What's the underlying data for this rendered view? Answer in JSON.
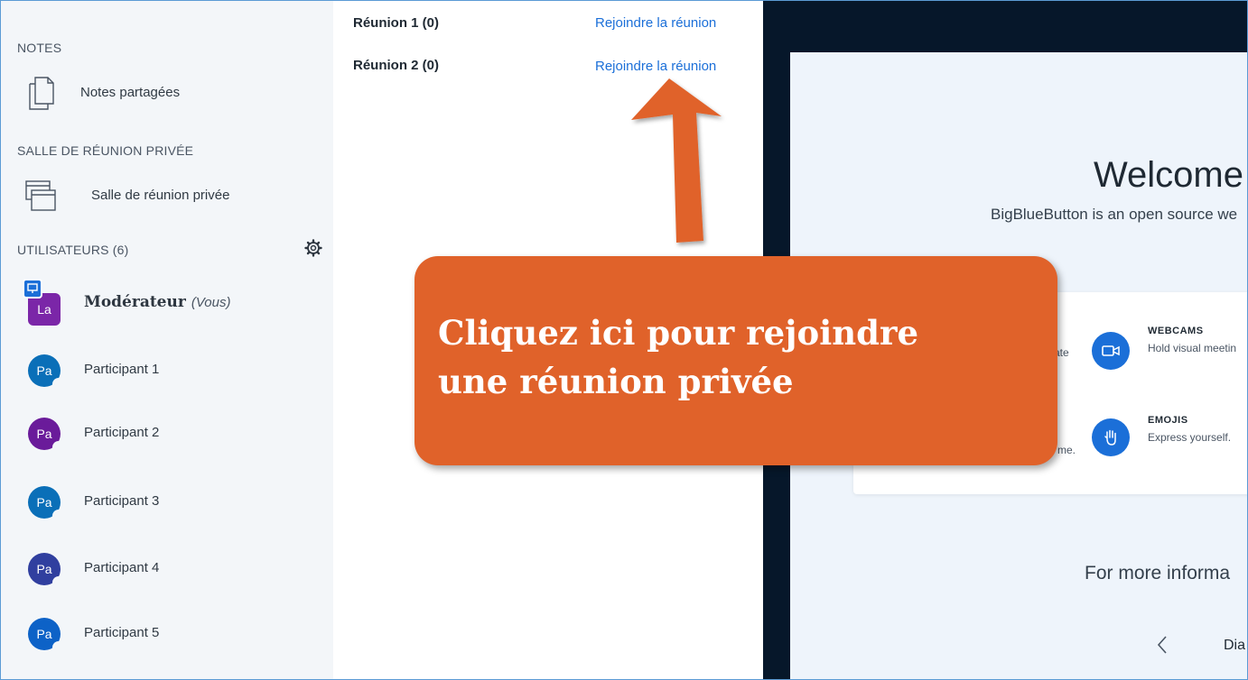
{
  "sidebar": {
    "notes_title": "NOTES",
    "notes_item": "Notes partagées",
    "breakout_title": "SALLE DE RÉUNION PRIVÉE",
    "breakout_item": "Salle de réunion privée",
    "users_title": "UTILISATEURS (6)",
    "moderator": {
      "initials": "La",
      "name": "Modérateur",
      "you": "(Vous)",
      "color": "#7b26a8"
    },
    "users": [
      {
        "initials": "Pa",
        "name": "Participant 1",
        "color": "#0a6fb8"
      },
      {
        "initials": "Pa",
        "name": "Participant 2",
        "color": "#6a1b9a"
      },
      {
        "initials": "Pa",
        "name": "Participant 3",
        "color": "#0a6fb8"
      },
      {
        "initials": "Pa",
        "name": "Participant 4",
        "color": "#303f9f"
      },
      {
        "initials": "Pa",
        "name": "Participant 5",
        "color": "#0d62c7"
      }
    ]
  },
  "rooms": [
    {
      "name": "Réunion 1 (0)",
      "join": "Rejoindre la réunion"
    },
    {
      "name": "Réunion 2 (0)",
      "join": "Rejoindre la réunion"
    }
  ],
  "presentation": {
    "welcome": "Welcome T",
    "subtitle": "BigBlueButton is an open source we",
    "features": [
      {
        "title": "WEBCAMS",
        "desc": "Hold visual meetin",
        "icon": "webcam-icon"
      },
      {
        "title": "EMOJIS",
        "desc": "Express yourself.",
        "icon": "hand-icon"
      }
    ],
    "partial_left_1": "ate",
    "partial_left_2": "me.",
    "more_info": "For more informa",
    "slide_label": "Dia"
  },
  "callout": {
    "text": "Cliquez ici pour rejoindre une réunion privée",
    "color": "#e0622a"
  }
}
